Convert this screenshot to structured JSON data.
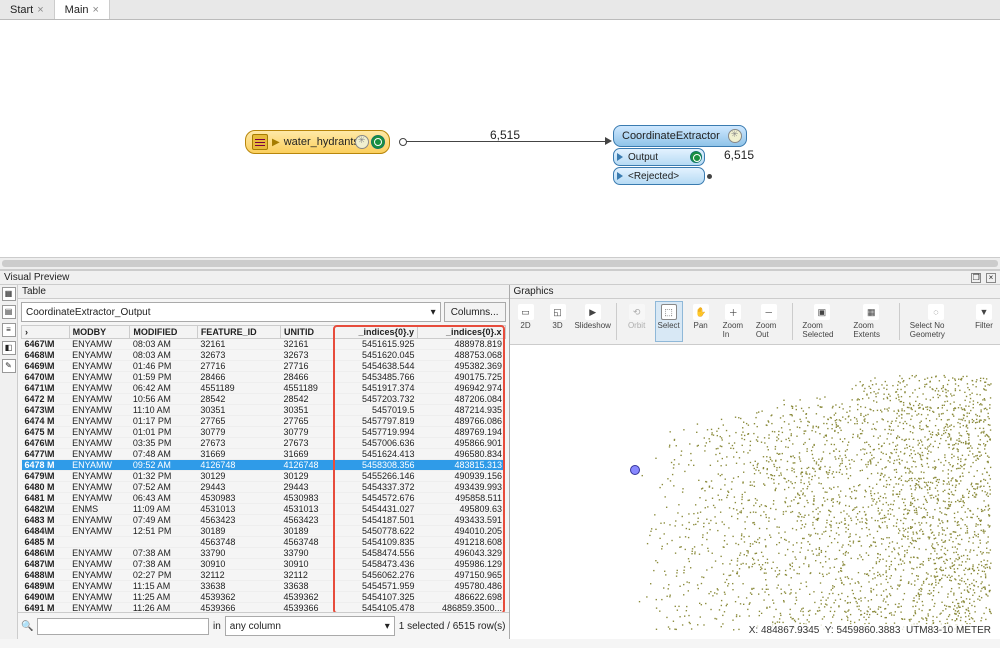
{
  "tabs": {
    "start": "Start",
    "main": "Main"
  },
  "canvas": {
    "source_label": "water_hydrants",
    "connection_count": "6,515",
    "transformer": "CoordinateExtractor",
    "port_output": "Output",
    "port_rejected": "<Rejected>",
    "output_count": "6,515"
  },
  "preview_title": "Visual Preview",
  "table_title": "Table",
  "graphics_title": "Graphics",
  "source_name": "CoordinateExtractor_Output",
  "columns_btn": "Columns...",
  "headers": {
    "rownum": "›",
    "modby": "MODBY",
    "modified": "MODIFIED",
    "feature_id": "FEATURE_ID",
    "unitid": "UNITID",
    "iy": "_indices{0}.y",
    "ix": "_indices{0}.x"
  },
  "rows": [
    {
      "n": "6467",
      "m": "\\M",
      "modby": "ENYAMW",
      "modified": "08:03 AM",
      "fid": "32161",
      "uid": "32161",
      "iy": "5451615.925",
      "ix": "488978.819"
    },
    {
      "n": "6468",
      "m": "\\M",
      "modby": "ENYAMW",
      "modified": "08:03 AM",
      "fid": "32673",
      "uid": "32673",
      "iy": "5451620.045",
      "ix": "488753.068"
    },
    {
      "n": "6469",
      "m": "\\M",
      "modby": "ENYAMW",
      "modified": "01:46 PM",
      "fid": "27716",
      "uid": "27716",
      "iy": "5454638.544",
      "ix": "495382.369"
    },
    {
      "n": "6470",
      "m": "\\M",
      "modby": "ENYAMW",
      "modified": "01:59 PM",
      "fid": "28466",
      "uid": "28466",
      "iy": "5453485.766",
      "ix": "490175.725"
    },
    {
      "n": "6471",
      "m": "\\M",
      "modby": "ENYAMW",
      "modified": "06:42 AM",
      "fid": "4551189",
      "uid": "4551189",
      "iy": "5451917.374",
      "ix": "496942.974"
    },
    {
      "n": "6472",
      "m": " M",
      "modby": "ENYAMW",
      "modified": "10:56 AM",
      "fid": "28542",
      "uid": "28542",
      "iy": "5457203.732",
      "ix": "487206.084"
    },
    {
      "n": "6473",
      "m": "\\M",
      "modby": "ENYAMW",
      "modified": "11:10 AM",
      "fid": "30351",
      "uid": "30351",
      "iy": "5457019.5",
      "ix": "487214.935"
    },
    {
      "n": "6474",
      "m": " M",
      "modby": "ENYAMW",
      "modified": "01:17 PM",
      "fid": "27765",
      "uid": "27765",
      "iy": "5457797.819",
      "ix": "489766.086"
    },
    {
      "n": "6475",
      "m": " M",
      "modby": "ENYAMW",
      "modified": "01:01 PM",
      "fid": "30779",
      "uid": "30779",
      "iy": "5457719.994",
      "ix": "489769.194"
    },
    {
      "n": "6476",
      "m": "\\M",
      "modby": "ENYAMW",
      "modified": "03:35 PM",
      "fid": "27673",
      "uid": "27673",
      "iy": "5457006.636",
      "ix": "495866.901"
    },
    {
      "n": "6477",
      "m": "\\M",
      "modby": "ENYAMW",
      "modified": "07:48 AM",
      "fid": "31669",
      "uid": "31669",
      "iy": "5451624.413",
      "ix": "496580.834"
    },
    {
      "n": "6478",
      "m": " M",
      "modby": "ENYAMW",
      "modified": "09:52 AM",
      "fid": "4126748",
      "uid": "4126748",
      "iy": "5458308.356",
      "ix": "483815.313",
      "sel": true
    },
    {
      "n": "6479",
      "m": "\\M",
      "modby": "ENYAMW",
      "modified": "01:32 PM",
      "fid": "30129",
      "uid": "30129",
      "iy": "5455266.146",
      "ix": "490939.156"
    },
    {
      "n": "6480",
      "m": " M",
      "modby": "ENYAMW",
      "modified": "07:52 AM",
      "fid": "29443",
      "uid": "29443",
      "iy": "5454337.372",
      "ix": "493439.993"
    },
    {
      "n": "6481",
      "m": " M",
      "modby": "ENYAMW",
      "modified": "06:43 AM",
      "fid": "4530983",
      "uid": "4530983",
      "iy": "5454572.676",
      "ix": "495858.511"
    },
    {
      "n": "6482",
      "m": "\\M",
      "modby": "ENMS",
      "modified": "11:09 AM",
      "fid": "4531013",
      "uid": "4531013",
      "iy": "5454431.027",
      "ix": "495809.63"
    },
    {
      "n": "6483",
      "m": " M",
      "modby": "ENYAMW",
      "modified": "07:49 AM",
      "fid": "4563423",
      "uid": "4563423",
      "iy": "5454187.501",
      "ix": "493433.591"
    },
    {
      "n": "6484",
      "m": "\\M",
      "modby": "ENYAMW",
      "modified": "12:51 PM",
      "fid": "30189",
      "uid": "30189",
      "iy": "5450778.622",
      "ix": "494010.205"
    },
    {
      "n": "6485",
      "m": " M",
      "modby": "",
      "modified": "",
      "fid": "4563748",
      "uid": "4563748",
      "iy": "5454109.835",
      "ix": "491218.608"
    },
    {
      "n": "6486",
      "m": "\\M",
      "modby": "ENYAMW",
      "modified": "07:38 AM",
      "fid": "33790",
      "uid": "33790",
      "iy": "5458474.556",
      "ix": "496043.329"
    },
    {
      "n": "6487",
      "m": "\\M",
      "modby": "ENYAMW",
      "modified": "07:38 AM",
      "fid": "30910",
      "uid": "30910",
      "iy": "5458473.436",
      "ix": "495986.129"
    },
    {
      "n": "6488",
      "m": "\\M",
      "modby": "ENYAMW",
      "modified": "02:27 PM",
      "fid": "32112",
      "uid": "32112",
      "iy": "5456062.276",
      "ix": "497150.965"
    },
    {
      "n": "6489",
      "m": "\\M",
      "modby": "ENYAMW",
      "modified": "11:15 AM",
      "fid": "33638",
      "uid": "33638",
      "iy": "5454571.959",
      "ix": "495780.486"
    },
    {
      "n": "6490",
      "m": "\\M",
      "modby": "ENYAMW",
      "modified": "11:25 AM",
      "fid": "4539362",
      "uid": "4539362",
      "iy": "5454107.325",
      "ix": "486622.698"
    },
    {
      "n": "6491",
      "m": " M",
      "modby": "ENYAMW",
      "modified": "11:26 AM",
      "fid": "4539366",
      "uid": "4539366",
      "iy": "5454105.478",
      "ix": "486859.3500..."
    }
  ],
  "search": {
    "placeholder": "",
    "in_label": "in",
    "column_option": "any column",
    "status": "1 selected / 6515 row(s)"
  },
  "toolbar": {
    "b2d": "2D",
    "b3d": "3D",
    "slideshow": "Slideshow",
    "orbit": "Orbit",
    "select": "Select",
    "pan": "Pan",
    "zoomin": "Zoom In",
    "zoomout": "Zoom Out",
    "zoomsel": "Zoom Selected",
    "zoomext": "Zoom Extents",
    "selnogeo": "Select No Geometry",
    "filter": "Filter"
  },
  "map_status": {
    "x_label": "X:",
    "x": "484867.9345",
    "y_label": "Y:",
    "y": "5459860.3883",
    "crs": "UTM83-10",
    "unit": "METER"
  }
}
